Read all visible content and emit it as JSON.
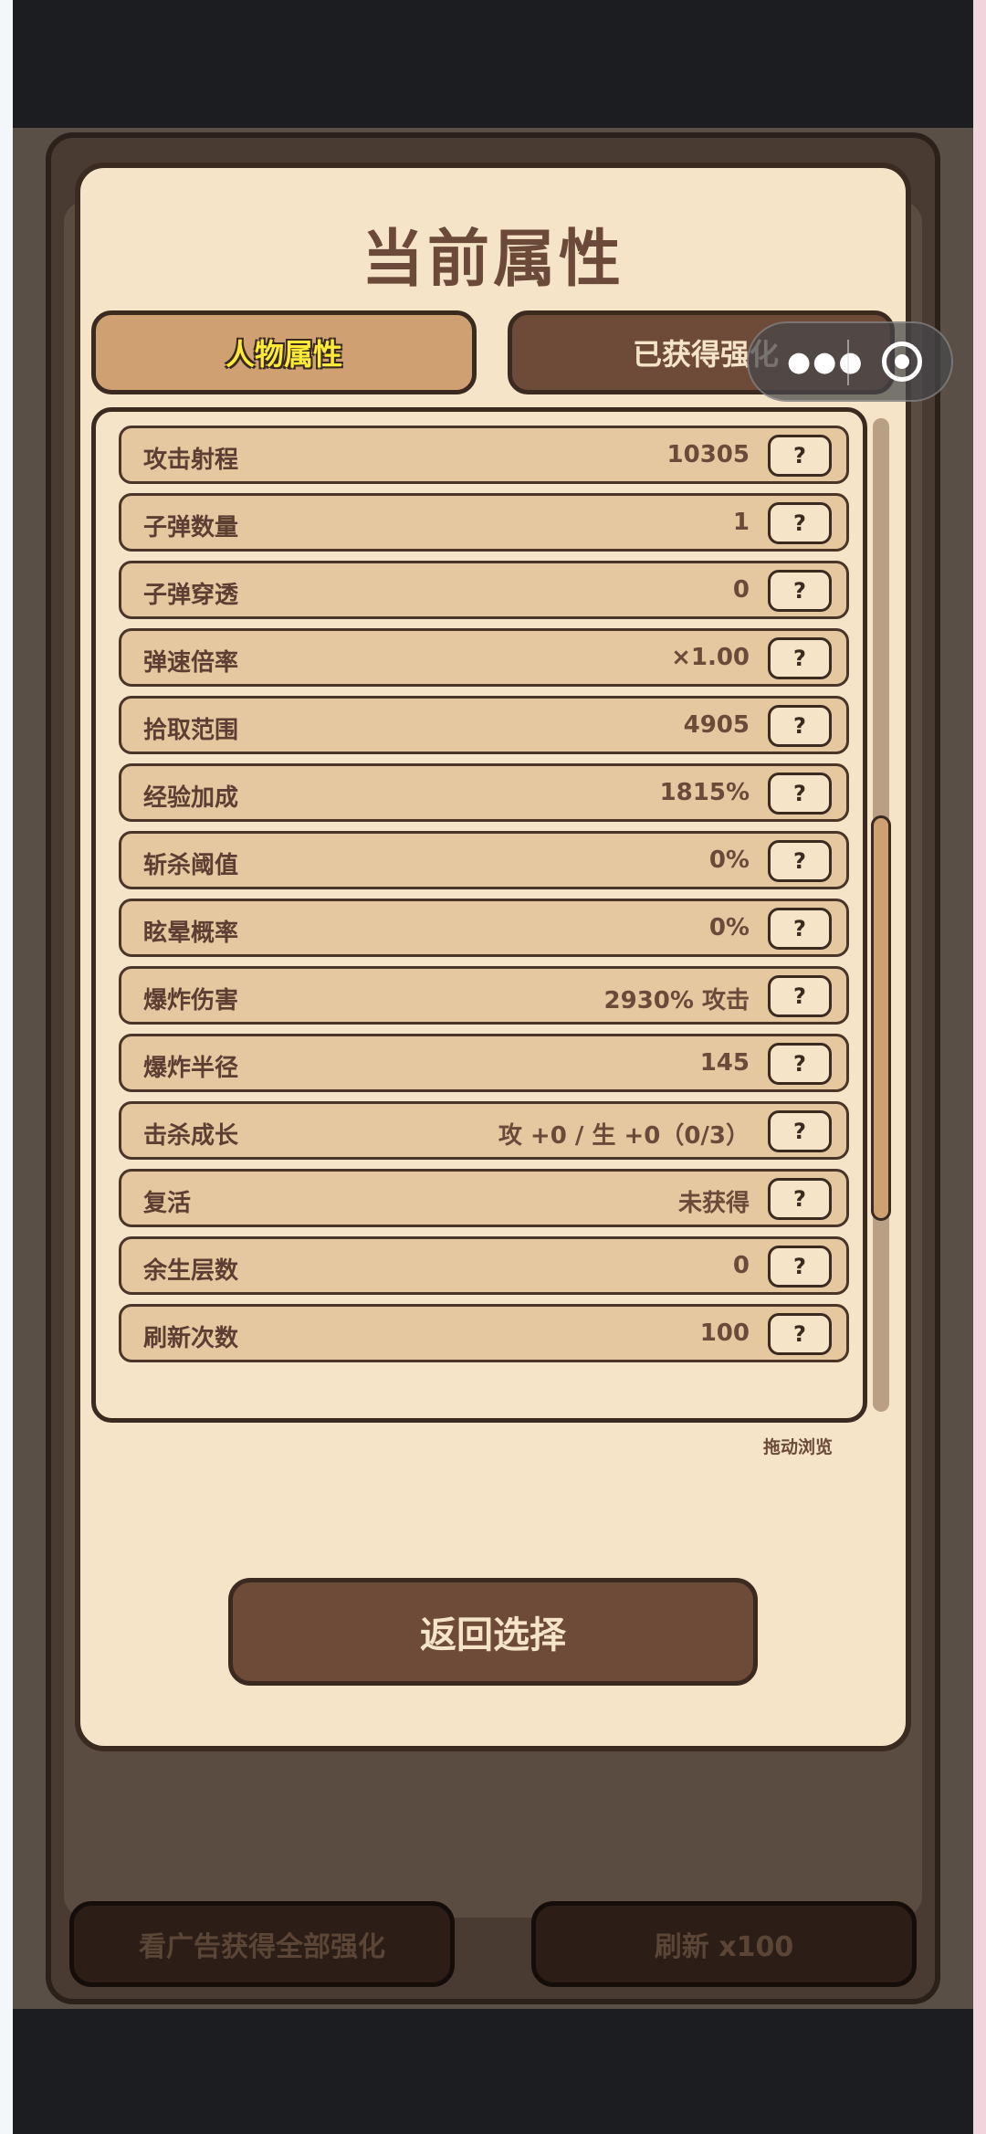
{
  "title": "当前属性",
  "tabs": [
    {
      "label": "人物属性",
      "active": true
    },
    {
      "label": "已获得强化",
      "active": false
    }
  ],
  "capsule": {
    "more_icon": "more-dots-icon",
    "close_icon": "target-close-icon"
  },
  "attributes": [
    {
      "label": "攻击射程",
      "value": "10305"
    },
    {
      "label": "子弹数量",
      "value": "1"
    },
    {
      "label": "子弹穿透",
      "value": "0"
    },
    {
      "label": "弹速倍率",
      "value": "×1.00"
    },
    {
      "label": "拾取范围",
      "value": "4905"
    },
    {
      "label": "经验加成",
      "value": "1815%"
    },
    {
      "label": "斩杀阈值",
      "value": "0%"
    },
    {
      "label": "眩晕概率",
      "value": "0%"
    },
    {
      "label": "爆炸伤害",
      "value": "2930% 攻击"
    },
    {
      "label": "爆炸半径",
      "value": "145"
    },
    {
      "label": "击杀成长",
      "value": "攻 +0 / 生 +0（0/3）"
    },
    {
      "label": "复活",
      "value": "未获得"
    },
    {
      "label": "余生层数",
      "value": "0"
    },
    {
      "label": "刷新次数",
      "value": "100"
    }
  ],
  "help_label": "?",
  "hint": "拖动浏览",
  "back_button": "返回选择",
  "bottom_buttons": {
    "watch_ad": "看广告获得全部强化",
    "refresh": "刷新 x100"
  },
  "colors": {
    "panel": "#f5e4c7",
    "accent": "#6e4a38",
    "tab_active": "#cfa172",
    "tab_text_active": "#ffea3a"
  }
}
